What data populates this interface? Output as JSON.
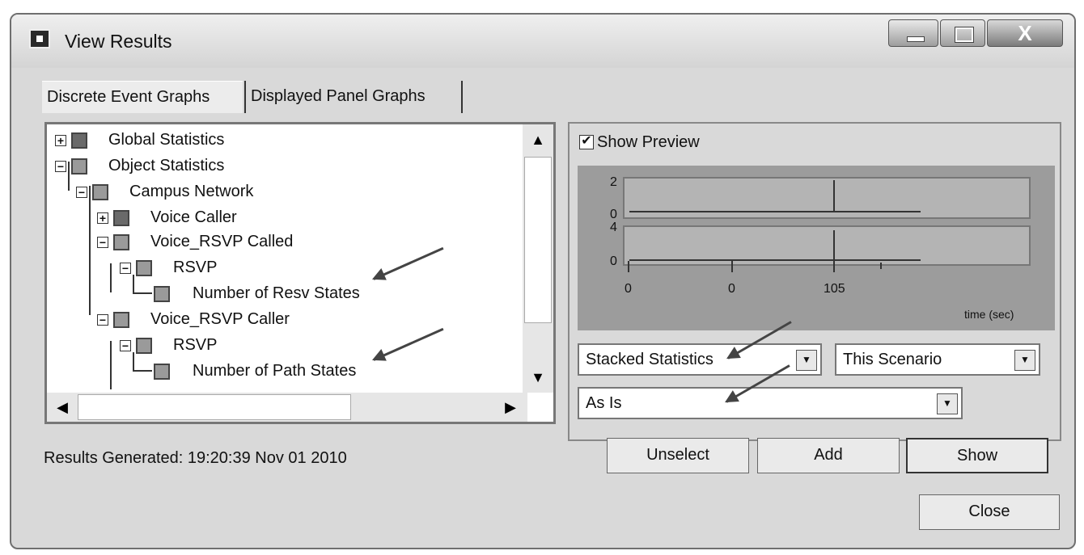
{
  "window": {
    "title": "View Results"
  },
  "titlebar": {
    "close_glyph": "X"
  },
  "tabs": [
    {
      "label": "Discrete Event Graphs"
    },
    {
      "label": "Displayed Panel Graphs"
    }
  ],
  "tree": {
    "items": [
      {
        "label": "Global Statistics"
      },
      {
        "label": "Object Statistics"
      },
      {
        "label": "Campus Network"
      },
      {
        "label": "Voice Caller"
      },
      {
        "label": "Voice_RSVP Called"
      },
      {
        "label": "RSVP"
      },
      {
        "label": "Number of Resv States"
      },
      {
        "label": "Voice_RSVP Caller"
      },
      {
        "label": "RSVP"
      },
      {
        "label": "Number of Path States"
      }
    ],
    "scroll": {
      "up": "▲",
      "down": "▼",
      "left": "◀",
      "right": "▶"
    }
  },
  "status": {
    "text": "Results Generated: 19:20:39 Nov 01 2010"
  },
  "preview": {
    "checkbox_mark": "✔",
    "label": "Show Preview",
    "chart_data": {
      "type": "line",
      "panels": [
        {
          "yticks": [
            "2",
            "0"
          ]
        },
        {
          "yticks": [
            "4",
            "0"
          ]
        }
      ],
      "xticks": [
        "0",
        "0",
        "105"
      ],
      "xlabel": "time (sec)"
    }
  },
  "dropdowns": {
    "stack_mode": "Stacked Statistics",
    "scenario": "This Scenario",
    "filter": "As Is",
    "arrow": "▼"
  },
  "buttons": {
    "unselect": "Unselect",
    "add": "Add",
    "show": "Show",
    "close": "Close"
  },
  "colors": {
    "window_bg": "#d9d9d9",
    "preview_bg": "#9c9c9c"
  },
  "icons": [
    "app-icon",
    "minimize-icon",
    "maximize-icon",
    "close-icon",
    "check-icon",
    "dropdown-arrow-icon"
  ]
}
